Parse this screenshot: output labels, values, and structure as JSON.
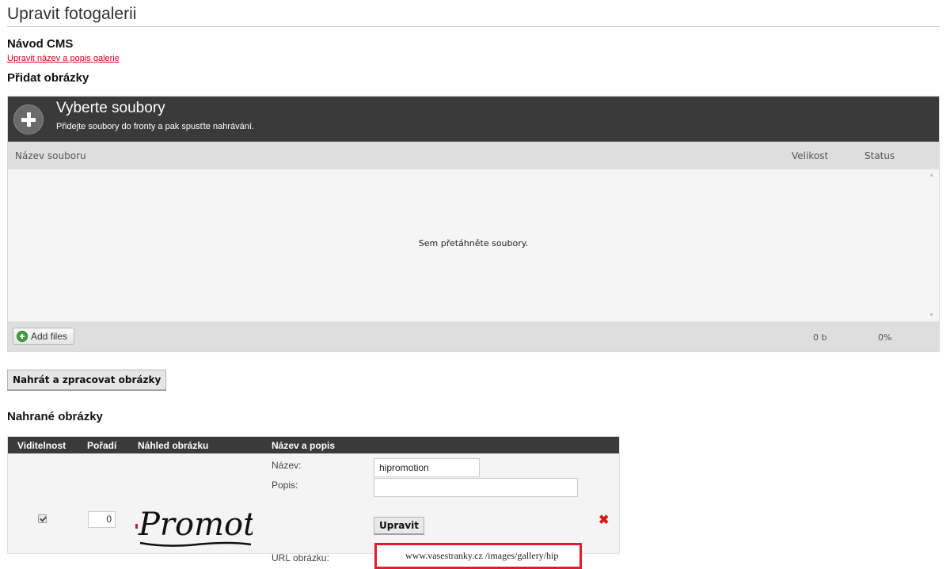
{
  "page": {
    "title": "Upravit fotogalerii",
    "guide_heading": "Návod CMS",
    "edit_link": "Upravit název a popis galerie",
    "add_images_heading": "Přidat obrázky",
    "uploaded_heading": "Nahrané obrázky"
  },
  "uploader": {
    "title": "Vyberte soubory",
    "subtitle": "Přidejte soubory do fronty a pak spusťte nahrávání.",
    "col_name": "Název souboru",
    "col_size": "Velikost",
    "col_status": "Status",
    "drop_text": "Sem přetáhněte soubory.",
    "add_files_label": "Add files",
    "total_size": "0 b",
    "total_percent": "0%"
  },
  "process_button": "Nahrát a zpracovat obrázky",
  "table": {
    "headers": [
      "Viditelnost",
      "Pořadí",
      "Náhled obrázku",
      "Název a popis"
    ],
    "rows": [
      {
        "visible": true,
        "order": "0",
        "thumbnail_text": "Promot",
        "name_label": "Název:",
        "name_value": "hipromotion",
        "desc_label": "Popis:",
        "desc_value": "",
        "edit_button": "Upravit",
        "url_label": "URL obrázku:",
        "url_value": "www.vasestranky.cz /images/gallery/hip"
      }
    ]
  },
  "colors": {
    "dark_bar": "#3a3a3a",
    "link_red": "#d0021b",
    "highlight_red": "#e8192c"
  }
}
